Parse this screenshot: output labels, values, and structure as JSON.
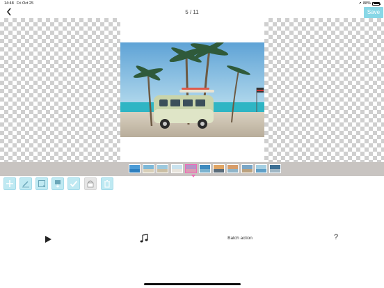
{
  "status_bar": {
    "time": "14:48",
    "date": "Fri Oct 25",
    "battery": "88%"
  },
  "header": {
    "back_icon": "chevron-left-icon",
    "counter": "5 / 11",
    "save_label": "Save"
  },
  "filmstrip": {
    "total": 11,
    "active_index": 4,
    "thumbs": [
      "sea-blue",
      "beach",
      "shore",
      "sky",
      "van-active",
      "water",
      "sunset",
      "beach-warm",
      "palm",
      "sea-light",
      "sea-dark"
    ]
  },
  "toolbar": {
    "tools": [
      {
        "name": "add-image-button",
        "icon": "plus-icon",
        "enabled": true
      },
      {
        "name": "edit-button",
        "icon": "pencil-icon",
        "enabled": true
      },
      {
        "name": "text-button",
        "icon": "text-icon",
        "enabled": true
      },
      {
        "name": "save-image-button",
        "icon": "download-icon",
        "enabled": true
      },
      {
        "name": "check-button",
        "icon": "checkmark-icon",
        "enabled": true
      },
      {
        "name": "lock-button",
        "icon": "lock-icon",
        "enabled": false
      },
      {
        "name": "delete-button",
        "icon": "trash-icon",
        "enabled": true
      }
    ]
  },
  "bottom_bar": {
    "play_icon": "play-icon",
    "music_icon": "music-note-icon",
    "batch_label": "Batch action",
    "help_label": "?"
  },
  "colors": {
    "accent": "#88d7e6",
    "active_thumb": "#f06ab8",
    "strip_bg": "#c8c4c1"
  }
}
